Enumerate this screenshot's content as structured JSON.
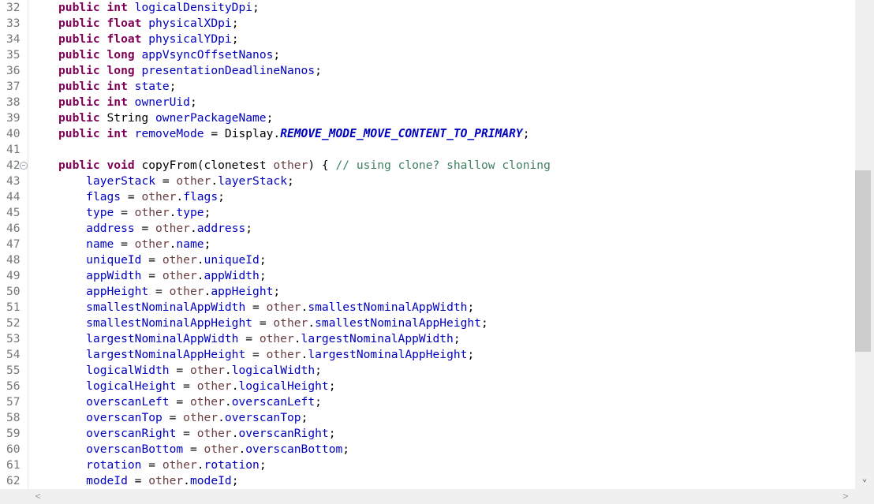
{
  "editor": {
    "lines": [
      {
        "no": "32",
        "tokens": [
          [
            "kw",
            "public"
          ],
          [
            "t",
            " "
          ],
          [
            "kw",
            "int"
          ],
          [
            "t",
            " "
          ],
          [
            "fld",
            "logicalDensityDpi"
          ],
          [
            "t",
            ";"
          ]
        ]
      },
      {
        "no": "33",
        "tokens": [
          [
            "kw",
            "public"
          ],
          [
            "t",
            " "
          ],
          [
            "kw",
            "float"
          ],
          [
            "t",
            " "
          ],
          [
            "fld",
            "physicalXDpi"
          ],
          [
            "t",
            ";"
          ]
        ]
      },
      {
        "no": "34",
        "tokens": [
          [
            "kw",
            "public"
          ],
          [
            "t",
            " "
          ],
          [
            "kw",
            "float"
          ],
          [
            "t",
            " "
          ],
          [
            "fld",
            "physicalYDpi"
          ],
          [
            "t",
            ";"
          ]
        ]
      },
      {
        "no": "35",
        "tokens": [
          [
            "kw",
            "public"
          ],
          [
            "t",
            " "
          ],
          [
            "kw",
            "long"
          ],
          [
            "t",
            " "
          ],
          [
            "fld",
            "appVsyncOffsetNanos"
          ],
          [
            "t",
            ";"
          ]
        ]
      },
      {
        "no": "36",
        "tokens": [
          [
            "kw",
            "public"
          ],
          [
            "t",
            " "
          ],
          [
            "kw",
            "long"
          ],
          [
            "t",
            " "
          ],
          [
            "fld",
            "presentationDeadlineNanos"
          ],
          [
            "t",
            ";"
          ]
        ]
      },
      {
        "no": "37",
        "tokens": [
          [
            "kw",
            "public"
          ],
          [
            "t",
            " "
          ],
          [
            "kw",
            "int"
          ],
          [
            "t",
            " "
          ],
          [
            "fld",
            "state"
          ],
          [
            "t",
            ";"
          ]
        ]
      },
      {
        "no": "38",
        "tokens": [
          [
            "kw",
            "public"
          ],
          [
            "t",
            " "
          ],
          [
            "kw",
            "int"
          ],
          [
            "t",
            " "
          ],
          [
            "fld",
            "ownerUid"
          ],
          [
            "t",
            ";"
          ]
        ]
      },
      {
        "no": "39",
        "tokens": [
          [
            "kw",
            "public"
          ],
          [
            "t",
            " String "
          ],
          [
            "fld",
            "ownerPackageName"
          ],
          [
            "t",
            ";"
          ]
        ]
      },
      {
        "no": "40",
        "tokens": [
          [
            "kw",
            "public"
          ],
          [
            "t",
            " "
          ],
          [
            "kw",
            "int"
          ],
          [
            "t",
            " "
          ],
          [
            "fld",
            "removeMode"
          ],
          [
            "t",
            " = Display."
          ],
          [
            "sfld",
            "REMOVE_MODE_MOVE_CONTENT_TO_PRIMARY"
          ],
          [
            "t",
            ";"
          ]
        ]
      },
      {
        "no": "41",
        "tokens": []
      },
      {
        "no": "42",
        "fold": true,
        "tokens": [
          [
            "kw",
            "public"
          ],
          [
            "t",
            " "
          ],
          [
            "kw",
            "void"
          ],
          [
            "t",
            " copyFrom(clonetest "
          ],
          [
            "loc",
            "other"
          ],
          [
            "t",
            ") { "
          ],
          [
            "cmt",
            "// using clone? shallow cloning"
          ]
        ]
      },
      {
        "no": "43",
        "tokens": [
          [
            "t",
            "    "
          ],
          [
            "fld",
            "layerStack"
          ],
          [
            "t",
            " = "
          ],
          [
            "loc",
            "other"
          ],
          [
            "t",
            "."
          ],
          [
            "fld",
            "layerStack"
          ],
          [
            "t",
            ";"
          ]
        ]
      },
      {
        "no": "44",
        "tokens": [
          [
            "t",
            "    "
          ],
          [
            "fld",
            "flags"
          ],
          [
            "t",
            " = "
          ],
          [
            "loc",
            "other"
          ],
          [
            "t",
            "."
          ],
          [
            "fld",
            "flags"
          ],
          [
            "t",
            ";"
          ]
        ]
      },
      {
        "no": "45",
        "tokens": [
          [
            "t",
            "    "
          ],
          [
            "fld",
            "type"
          ],
          [
            "t",
            " = "
          ],
          [
            "loc",
            "other"
          ],
          [
            "t",
            "."
          ],
          [
            "fld",
            "type"
          ],
          [
            "t",
            ";"
          ]
        ]
      },
      {
        "no": "46",
        "tokens": [
          [
            "t",
            "    "
          ],
          [
            "fld",
            "address"
          ],
          [
            "t",
            " = "
          ],
          [
            "loc",
            "other"
          ],
          [
            "t",
            "."
          ],
          [
            "fld",
            "address"
          ],
          [
            "t",
            ";"
          ]
        ]
      },
      {
        "no": "47",
        "tokens": [
          [
            "t",
            "    "
          ],
          [
            "fld",
            "name"
          ],
          [
            "t",
            " = "
          ],
          [
            "loc",
            "other"
          ],
          [
            "t",
            "."
          ],
          [
            "fld",
            "name"
          ],
          [
            "t",
            ";"
          ]
        ]
      },
      {
        "no": "48",
        "tokens": [
          [
            "t",
            "    "
          ],
          [
            "fld",
            "uniqueId"
          ],
          [
            "t",
            " = "
          ],
          [
            "loc",
            "other"
          ],
          [
            "t",
            "."
          ],
          [
            "fld",
            "uniqueId"
          ],
          [
            "t",
            ";"
          ]
        ]
      },
      {
        "no": "49",
        "tokens": [
          [
            "t",
            "    "
          ],
          [
            "fld",
            "appWidth"
          ],
          [
            "t",
            " = "
          ],
          [
            "loc",
            "other"
          ],
          [
            "t",
            "."
          ],
          [
            "fld",
            "appWidth"
          ],
          [
            "t",
            ";"
          ]
        ]
      },
      {
        "no": "50",
        "tokens": [
          [
            "t",
            "    "
          ],
          [
            "fld",
            "appHeight"
          ],
          [
            "t",
            " = "
          ],
          [
            "loc",
            "other"
          ],
          [
            "t",
            "."
          ],
          [
            "fld",
            "appHeight"
          ],
          [
            "t",
            ";"
          ]
        ]
      },
      {
        "no": "51",
        "tokens": [
          [
            "t",
            "    "
          ],
          [
            "fld",
            "smallestNominalAppWidth"
          ],
          [
            "t",
            " = "
          ],
          [
            "loc",
            "other"
          ],
          [
            "t",
            "."
          ],
          [
            "fld",
            "smallestNominalAppWidth"
          ],
          [
            "t",
            ";"
          ]
        ]
      },
      {
        "no": "52",
        "tokens": [
          [
            "t",
            "    "
          ],
          [
            "fld",
            "smallestNominalAppHeight"
          ],
          [
            "t",
            " = "
          ],
          [
            "loc",
            "other"
          ],
          [
            "t",
            "."
          ],
          [
            "fld",
            "smallestNominalAppHeight"
          ],
          [
            "t",
            ";"
          ]
        ]
      },
      {
        "no": "53",
        "tokens": [
          [
            "t",
            "    "
          ],
          [
            "fld",
            "largestNominalAppWidth"
          ],
          [
            "t",
            " = "
          ],
          [
            "loc",
            "other"
          ],
          [
            "t",
            "."
          ],
          [
            "fld",
            "largestNominalAppWidth"
          ],
          [
            "t",
            ";"
          ]
        ]
      },
      {
        "no": "54",
        "tokens": [
          [
            "t",
            "    "
          ],
          [
            "fld",
            "largestNominalAppHeight"
          ],
          [
            "t",
            " = "
          ],
          [
            "loc",
            "other"
          ],
          [
            "t",
            "."
          ],
          [
            "fld",
            "largestNominalAppHeight"
          ],
          [
            "t",
            ";"
          ]
        ]
      },
      {
        "no": "55",
        "tokens": [
          [
            "t",
            "    "
          ],
          [
            "fld",
            "logicalWidth"
          ],
          [
            "t",
            " = "
          ],
          [
            "loc",
            "other"
          ],
          [
            "t",
            "."
          ],
          [
            "fld",
            "logicalWidth"
          ],
          [
            "t",
            ";"
          ]
        ]
      },
      {
        "no": "56",
        "tokens": [
          [
            "t",
            "    "
          ],
          [
            "fld",
            "logicalHeight"
          ],
          [
            "t",
            " = "
          ],
          [
            "loc",
            "other"
          ],
          [
            "t",
            "."
          ],
          [
            "fld",
            "logicalHeight"
          ],
          [
            "t",
            ";"
          ]
        ]
      },
      {
        "no": "57",
        "tokens": [
          [
            "t",
            "    "
          ],
          [
            "fld",
            "overscanLeft"
          ],
          [
            "t",
            " = "
          ],
          [
            "loc",
            "other"
          ],
          [
            "t",
            "."
          ],
          [
            "fld",
            "overscanLeft"
          ],
          [
            "t",
            ";"
          ]
        ]
      },
      {
        "no": "58",
        "tokens": [
          [
            "t",
            "    "
          ],
          [
            "fld",
            "overscanTop"
          ],
          [
            "t",
            " = "
          ],
          [
            "loc",
            "other"
          ],
          [
            "t",
            "."
          ],
          [
            "fld",
            "overscanTop"
          ],
          [
            "t",
            ";"
          ]
        ]
      },
      {
        "no": "59",
        "tokens": [
          [
            "t",
            "    "
          ],
          [
            "fld",
            "overscanRight"
          ],
          [
            "t",
            " = "
          ],
          [
            "loc",
            "other"
          ],
          [
            "t",
            "."
          ],
          [
            "fld",
            "overscanRight"
          ],
          [
            "t",
            ";"
          ]
        ]
      },
      {
        "no": "60",
        "tokens": [
          [
            "t",
            "    "
          ],
          [
            "fld",
            "overscanBottom"
          ],
          [
            "t",
            " = "
          ],
          [
            "loc",
            "other"
          ],
          [
            "t",
            "."
          ],
          [
            "fld",
            "overscanBottom"
          ],
          [
            "t",
            ";"
          ]
        ]
      },
      {
        "no": "61",
        "tokens": [
          [
            "t",
            "    "
          ],
          [
            "fld",
            "rotation"
          ],
          [
            "t",
            " = "
          ],
          [
            "loc",
            "other"
          ],
          [
            "t",
            "."
          ],
          [
            "fld",
            "rotation"
          ],
          [
            "t",
            ";"
          ]
        ]
      },
      {
        "no": "62",
        "tokens": [
          [
            "t",
            "    "
          ],
          [
            "fld",
            "modeId"
          ],
          [
            "t",
            " = "
          ],
          [
            "loc",
            "other"
          ],
          [
            "t",
            "."
          ],
          [
            "fld",
            "modeId"
          ],
          [
            "t",
            ";"
          ]
        ]
      }
    ]
  },
  "scrollbars": {
    "vertical": {
      "up_icon": "▲",
      "down_icon": "▼",
      "position": 0.37
    },
    "horizontal": {
      "left_icon": "<",
      "right_icon": ">"
    }
  },
  "colors": {
    "keyword": "#7f0055",
    "field": "#0000c0",
    "local_variable": "#6a3e3e",
    "comment": "#3f7f5f",
    "line_number": "#787878"
  }
}
